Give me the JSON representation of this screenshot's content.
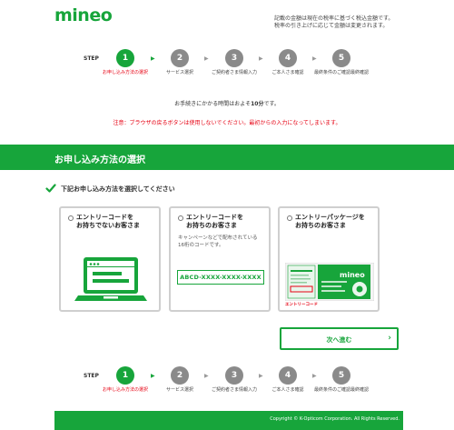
{
  "header": {
    "logo": "mineo",
    "tax_note_line1": "記載の金額は現在の税率に基づく税込金額です。",
    "tax_note_line2": "税率の引き上げに応じて金額は変更されます。"
  },
  "steps": {
    "label": "STEP",
    "items": [
      {
        "number": "1",
        "label": "お申し込み方法の選択"
      },
      {
        "number": "2",
        "label": "サービス選択"
      },
      {
        "number": "3",
        "label": "ご契約者さま情報入力"
      },
      {
        "number": "4",
        "label": "ご本人さま確認"
      },
      {
        "number": "5",
        "label": "最終条件のご確認最終確認"
      }
    ],
    "active_index": 0
  },
  "notes": {
    "time_prefix": "お手続きにかかる時間はおよそ",
    "time_value": "10分",
    "time_suffix": "です。",
    "warning": "注意：ブラウザの戻るボタンは使用しないでください。最初からの入力になってしまいます。"
  },
  "banner": {
    "title": "お申し込み方法の選択"
  },
  "instruction": "下記お申し込み方法を選択してください",
  "options": [
    {
      "title_line1": "エントリーコードを",
      "title_line2": "お持ちでないお客さま"
    },
    {
      "title_line1": "エントリーコードを",
      "title_line2": "お持ちのお客さま",
      "desc": "キャンペーンなどで配布されている16桁のコードです。",
      "code_sample": "ABCD-XXXX-XXXX-XXXX"
    },
    {
      "title_line1": "エントリーパッケージを",
      "title_line2": "お持ちのお客さま",
      "package_label": "エントリーコード",
      "package_logo": "mineo"
    }
  ],
  "next_button": {
    "label": "次へ進む",
    "chevron": "›"
  },
  "footer": {
    "copyright": "Copyright © K-Opticom Corporation. All Rights Reserved."
  },
  "colors": {
    "brand_green": "#17a53b",
    "warning_red": "#e60012",
    "inactive_step": "#8a8a8a"
  }
}
